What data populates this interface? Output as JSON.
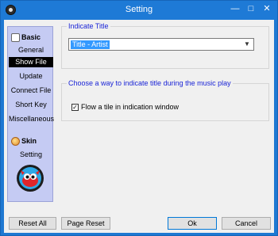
{
  "window": {
    "title": "Setting"
  },
  "sidebar": {
    "sections": [
      {
        "label": "Basic",
        "icon": "grid-icon"
      },
      {
        "label": "Skin",
        "icon": "palette-icon"
      }
    ],
    "basic_items": [
      "General",
      "Show File",
      "Update",
      "Connect File",
      "Short Key",
      "Miscellaneous"
    ],
    "skin_items": [
      "Setting"
    ],
    "selected": "Show File"
  },
  "indicate_title": {
    "group_label": "Indicate Title",
    "selected_value": "Title - Artist"
  },
  "music_play": {
    "group_label": "Choose a way to indicate title during the music play",
    "checkbox_label": "Flow a tile in indication window",
    "checked": true
  },
  "buttons": {
    "reset_all": "Reset All",
    "page_reset": "Page Reset",
    "ok": "Ok",
    "cancel": "Cancel"
  },
  "colors": {
    "titlebar": "#1e7ad6",
    "sidebar": "#c5cbf3",
    "group_title": "#1a24d6",
    "selection": "#3399ff"
  }
}
